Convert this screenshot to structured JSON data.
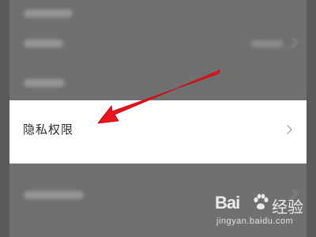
{
  "settings": {
    "highlighted_item": {
      "label": "隐私权限"
    }
  },
  "watermark": {
    "brand_prefix": "Bai",
    "brand_suffix": "经验",
    "url": "jingyan.baidu.com"
  },
  "colors": {
    "overlay": "#707070",
    "highlight_bg": "#ffffff",
    "arrow": "#e8141e"
  }
}
